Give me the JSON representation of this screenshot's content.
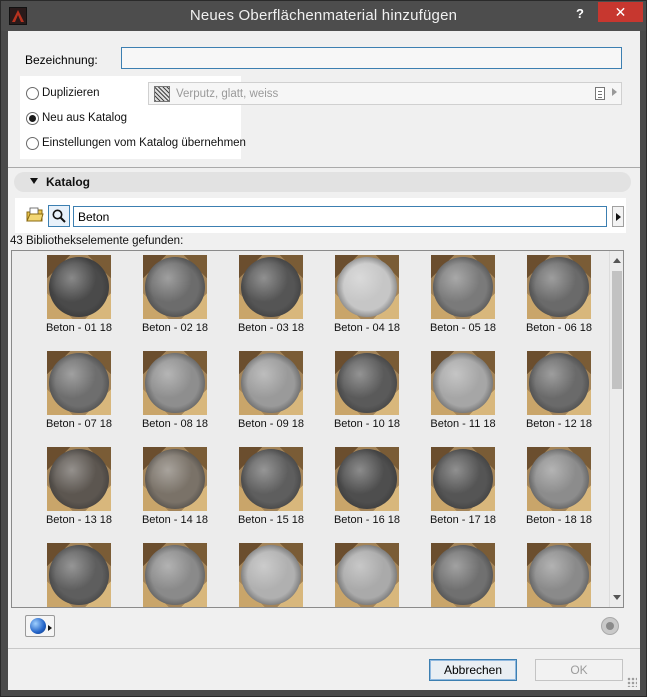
{
  "window": {
    "title": "Neues Oberflächenmaterial hinzufügen",
    "help_label": "?",
    "close_label": "✕"
  },
  "name_field": {
    "label": "Bezeichnung:",
    "value": ""
  },
  "options": [
    {
      "label": "Duplizieren",
      "selected": false
    },
    {
      "label": "Neu aus Katalog",
      "selected": true
    },
    {
      "label": "Einstellungen vom Katalog übernehmen",
      "selected": false
    }
  ],
  "material_field": {
    "placeholder": "Verputz, glatt, weiss"
  },
  "catalog": {
    "header": "Katalog",
    "search_value": "Beton",
    "found_text": "43 Bibliothekselemente gefunden:",
    "items": [
      "Beton - 01 18",
      "Beton - 02 18",
      "Beton - 03 18",
      "Beton - 04 18",
      "Beton - 05 18",
      "Beton - 06 18",
      "Beton - 07 18",
      "Beton - 08 18",
      "Beton - 09 18",
      "Beton - 10 18",
      "Beton - 11 18",
      "Beton - 12 18",
      "Beton - 13 18",
      "Beton - 14 18",
      "Beton - 15 18",
      "Beton - 16 18",
      "Beton - 17 18",
      "Beton - 18 18",
      "",
      "",
      "",
      "",
      "",
      ""
    ],
    "sphere_colors": [
      "#4a4a4a",
      "#6c6c6c",
      "#555555",
      "#c6c6c6",
      "#7a7a7a",
      "#6a6a6a",
      "#6e6e6e",
      "#8e8e8e",
      "#9a9a9a",
      "#5a5a5a",
      "#a6a6a6",
      "#6a6a6a",
      "#5c5650",
      "#7a7268",
      "#5e5e5e",
      "#4e4e4e",
      "#555555",
      "#8c8c8c",
      "#5e5e5e",
      "#8a8a8a",
      "#b0b0b0",
      "#aaaaaa",
      "#707070",
      "#8a8a8a"
    ]
  },
  "footer": {
    "cancel_label": "Abbrechen",
    "ok_label": "OK"
  },
  "colors": {
    "accent": "#3c7fb1",
    "close_red": "#c7372f"
  }
}
